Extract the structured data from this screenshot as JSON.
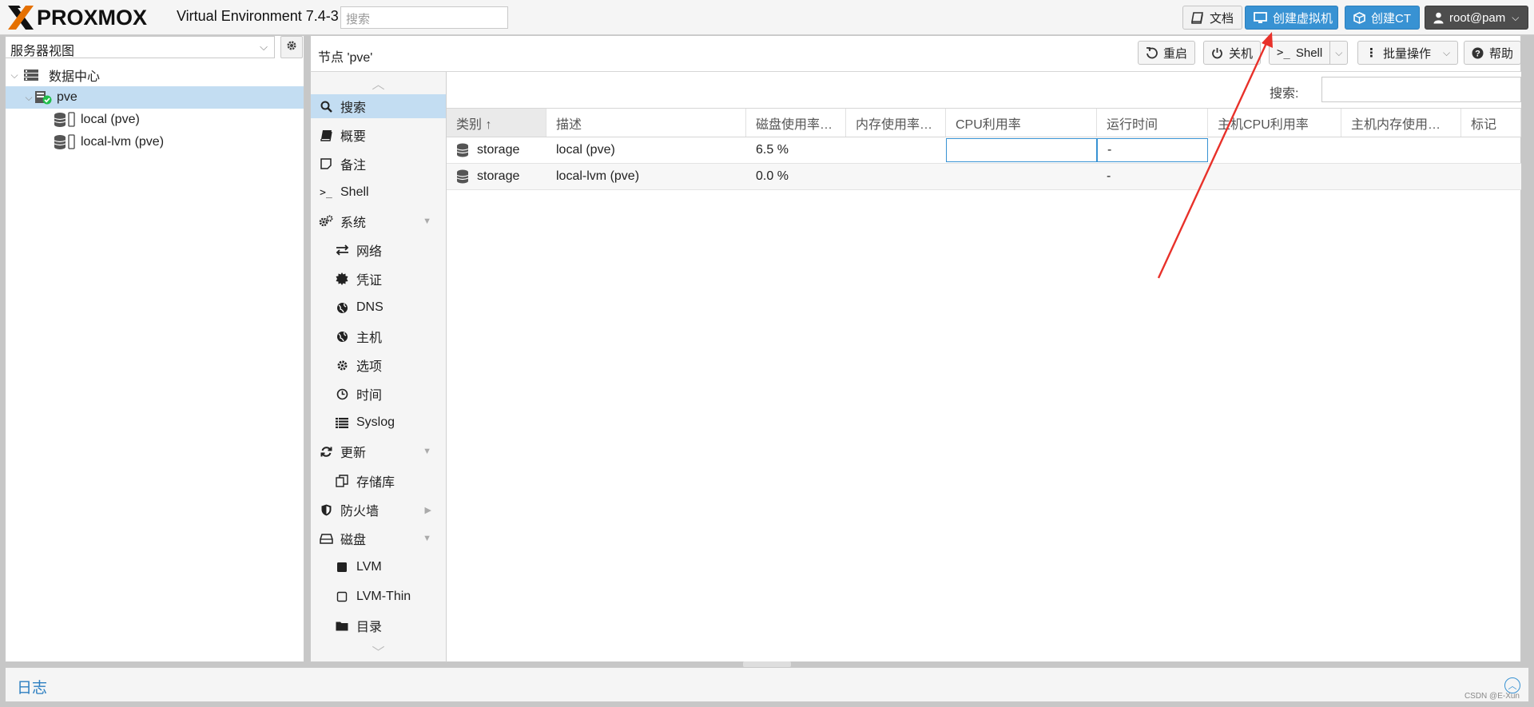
{
  "app": {
    "logo_text": "PROXMOX",
    "version": "Virtual Environment 7.4-3",
    "search_placeholder": "搜索"
  },
  "topbar": {
    "docs_label": "文档",
    "create_vm_label": "创建虚拟机",
    "create_ct_label": "创建CT",
    "user_label": "root@pam"
  },
  "tree": {
    "view_select": "服务器视图",
    "items": [
      {
        "label": "数据中心",
        "icon": "datacenter-icon"
      },
      {
        "label": "pve",
        "icon": "node-online-icon"
      },
      {
        "label": "local (pve)",
        "icon": "storage-icon"
      },
      {
        "label": "local-lvm (pve)",
        "icon": "storage-icon"
      }
    ]
  },
  "node": {
    "title": "节点 'pve'",
    "buttons": {
      "reboot": "重启",
      "shutdown": "关机",
      "shell": "Shell",
      "bulk": "批量操作",
      "help": "帮助"
    }
  },
  "nav": {
    "items": [
      {
        "label": "搜索",
        "icon": "search-icon"
      },
      {
        "label": "概要",
        "icon": "book-icon"
      },
      {
        "label": "备注",
        "icon": "note-icon"
      },
      {
        "label": "Shell",
        "icon": "terminal-icon"
      },
      {
        "label": "系统",
        "icon": "gears-icon"
      },
      {
        "label": "网络",
        "icon": "exchange-icon"
      },
      {
        "label": "凭证",
        "icon": "certificate-icon"
      },
      {
        "label": "DNS",
        "icon": "globe-icon"
      },
      {
        "label": "主机",
        "icon": "globe-icon"
      },
      {
        "label": "选项",
        "icon": "gear-icon"
      },
      {
        "label": "时间",
        "icon": "clock-icon"
      },
      {
        "label": "Syslog",
        "icon": "list-icon"
      },
      {
        "label": "更新",
        "icon": "refresh-icon"
      },
      {
        "label": "存储库",
        "icon": "files-icon"
      },
      {
        "label": "防火墙",
        "icon": "shield-icon"
      },
      {
        "label": "磁盘",
        "icon": "hdd-icon"
      },
      {
        "label": "LVM",
        "icon": "square-icon"
      },
      {
        "label": "LVM-Thin",
        "icon": "square-outline-icon"
      },
      {
        "label": "目录",
        "icon": "folder-icon"
      }
    ]
  },
  "content": {
    "search_label": "搜索:",
    "columns": [
      "类别 ↑",
      "描述",
      "磁盘使用率…",
      "内存使用率…",
      "CPU利用率",
      "运行时间",
      "主机CPU利用率",
      "主机内存使用…",
      "标记"
    ],
    "rows": [
      {
        "type": "storage",
        "desc": "local (pve)",
        "disk": "6.5 %",
        "mem": "",
        "cpu": "",
        "uptime": "-",
        "hostcpu": "",
        "hostmem": "",
        "tags": ""
      },
      {
        "type": "storage",
        "desc": "local-lvm (pve)",
        "disk": "0.0 %",
        "mem": "",
        "cpu": "",
        "uptime": "-",
        "hostcpu": "",
        "hostmem": "",
        "tags": ""
      }
    ]
  },
  "log": {
    "label": "日志"
  },
  "watermark": "CSDN @E-Xun",
  "colors": {
    "accent": "#3892d3",
    "selection": "#c3ddf2",
    "logo_orange": "#e57000",
    "annotation_red": "#e8312a"
  }
}
